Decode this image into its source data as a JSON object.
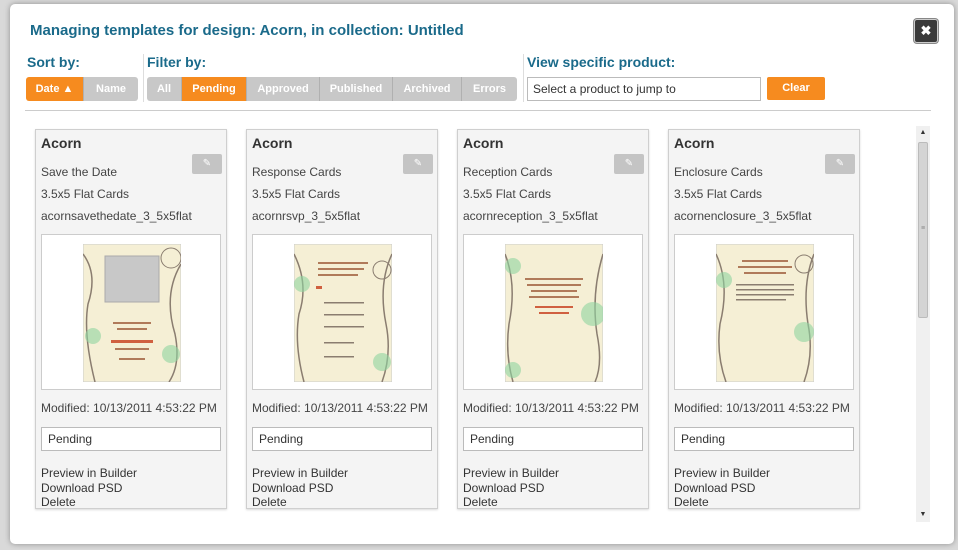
{
  "dialog": {
    "title": "Managing templates for design: Acorn, in collection: Untitled",
    "close_label": "✖"
  },
  "sort": {
    "label": "Sort by:",
    "options": [
      {
        "label": "Date ▲",
        "active": true
      },
      {
        "label": "Name",
        "active": false
      }
    ]
  },
  "filter": {
    "label": "Filter by:",
    "options": [
      {
        "label": "All",
        "active": false
      },
      {
        "label": "Pending",
        "active": true
      },
      {
        "label": "Approved",
        "active": false
      },
      {
        "label": "Published",
        "active": false
      },
      {
        "label": "Archived",
        "active": false
      },
      {
        "label": "Errors",
        "active": false
      }
    ]
  },
  "product": {
    "label": "View specific product:",
    "input_value": "Select a product to jump to",
    "clear_label": "Clear"
  },
  "cards": [
    {
      "title": "Acorn",
      "type": "Save the Date",
      "size": "3.5x5 Flat Cards",
      "code": "acornsavethedate_3_5x5flat",
      "modified": "Modified: 10/13/2011 4:53:22 PM",
      "status": "Pending",
      "preview": "Preview in Builder",
      "download": "Download PSD",
      "delete": "Delete"
    },
    {
      "title": "Acorn",
      "type": "Response Cards",
      "size": "3.5x5 Flat Cards",
      "code": "acornrsvp_3_5x5flat",
      "modified": "Modified: 10/13/2011 4:53:22 PM",
      "status": "Pending",
      "preview": "Preview in Builder",
      "download": "Download PSD",
      "delete": "Delete"
    },
    {
      "title": "Acorn",
      "type": "Reception Cards",
      "size": "3.5x5 Flat Cards",
      "code": "acornreception_3_5x5flat",
      "modified": "Modified: 10/13/2011 4:53:22 PM",
      "status": "Pending",
      "preview": "Preview in Builder",
      "download": "Download PSD",
      "delete": "Delete"
    },
    {
      "title": "Acorn",
      "type": "Enclosure Cards",
      "size": "3.5x5 Flat Cards",
      "code": "acornenclosure_3_5x5flat",
      "modified": "Modified: 10/13/2011 4:53:22 PM",
      "status": "Pending",
      "preview": "Preview in Builder",
      "download": "Download PSD",
      "delete": "Delete"
    }
  ],
  "icons": {
    "edit": "pencil-icon",
    "close": "close-icon"
  },
  "colors": {
    "accent": "#f68b1f",
    "title": "#1a6a8a",
    "button_inactive": "#c8c8c8"
  }
}
